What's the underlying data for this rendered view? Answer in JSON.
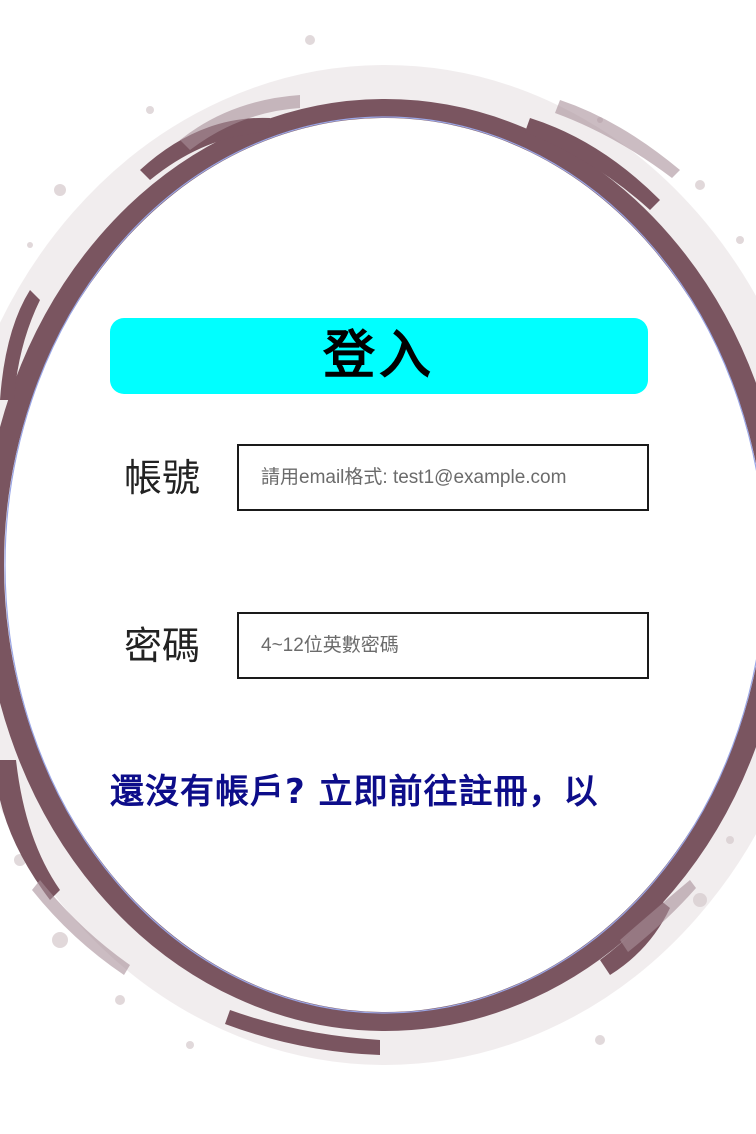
{
  "colors": {
    "ring": "#7a5560",
    "title_bg": "#00ffff",
    "link_text": "#0d0d8a"
  },
  "login": {
    "title": "登入"
  },
  "account": {
    "label": "帳號",
    "placeholder": "請用email格式: test1@example.com"
  },
  "password": {
    "label": "密碼",
    "placeholder": "4~12位英數密碼"
  },
  "register": {
    "text": "還沒有帳戶? 立即前往註冊，以"
  }
}
